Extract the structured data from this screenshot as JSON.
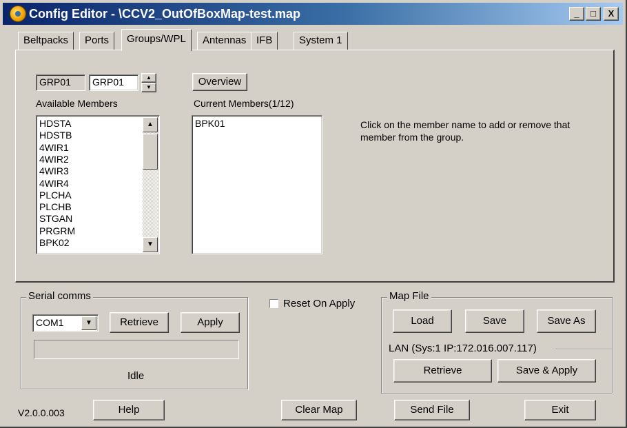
{
  "window": {
    "title": "Config Editor - \\CCV2_OutOfBoxMap-test.map",
    "minimize_glyph": "_",
    "maximize_glyph": "□",
    "close_glyph": "X"
  },
  "tabs": [
    {
      "label": "Beltpacks",
      "active": false
    },
    {
      "label": "Ports",
      "active": false
    },
    {
      "label": "Groups/WPL",
      "active": true
    },
    {
      "label": "Antennas",
      "active": false
    },
    {
      "label": "IFB",
      "active": false
    },
    {
      "label": "System 1",
      "active": false
    }
  ],
  "groups": {
    "group_id_display": "GRP01",
    "group_name_value": "GRP01",
    "overview_label": "Overview",
    "available_label": "Available Members",
    "current_label": "Current Members(1/12)",
    "available_members": [
      "HDSTA",
      "HDSTB",
      "4WIR1",
      "4WIR2",
      "4WIR3",
      "4WIR4",
      "PLCHA",
      "PLCHB",
      "STGAN",
      "PRGRM",
      "BPK02"
    ],
    "current_members": [
      "BPK01"
    ],
    "instructions": "Click on the member name to add or remove that member from the group."
  },
  "serial": {
    "title": "Serial comms",
    "port_value": "COM1",
    "retrieve_label": "Retrieve",
    "apply_label": "Apply",
    "status": "Idle"
  },
  "reset": {
    "label": "Reset On Apply",
    "checked": false
  },
  "mapfile": {
    "title": "Map File",
    "load_label": "Load",
    "save_label": "Save",
    "save_as_label": "Save As",
    "lan_label": "LAN  (Sys:1 IP:172.016.007.117)",
    "retrieve_label": "Retrieve",
    "save_apply_label": "Save & Apply"
  },
  "footer": {
    "version": "V2.0.0.003",
    "help_label": "Help",
    "clear_map_label": "Clear Map",
    "send_file_label": "Send File",
    "exit_label": "Exit"
  },
  "icons": {
    "spin_up": "▲",
    "spin_down": "▼",
    "scroll_up": "▲",
    "scroll_down": "▼",
    "dropdown": "▼"
  }
}
